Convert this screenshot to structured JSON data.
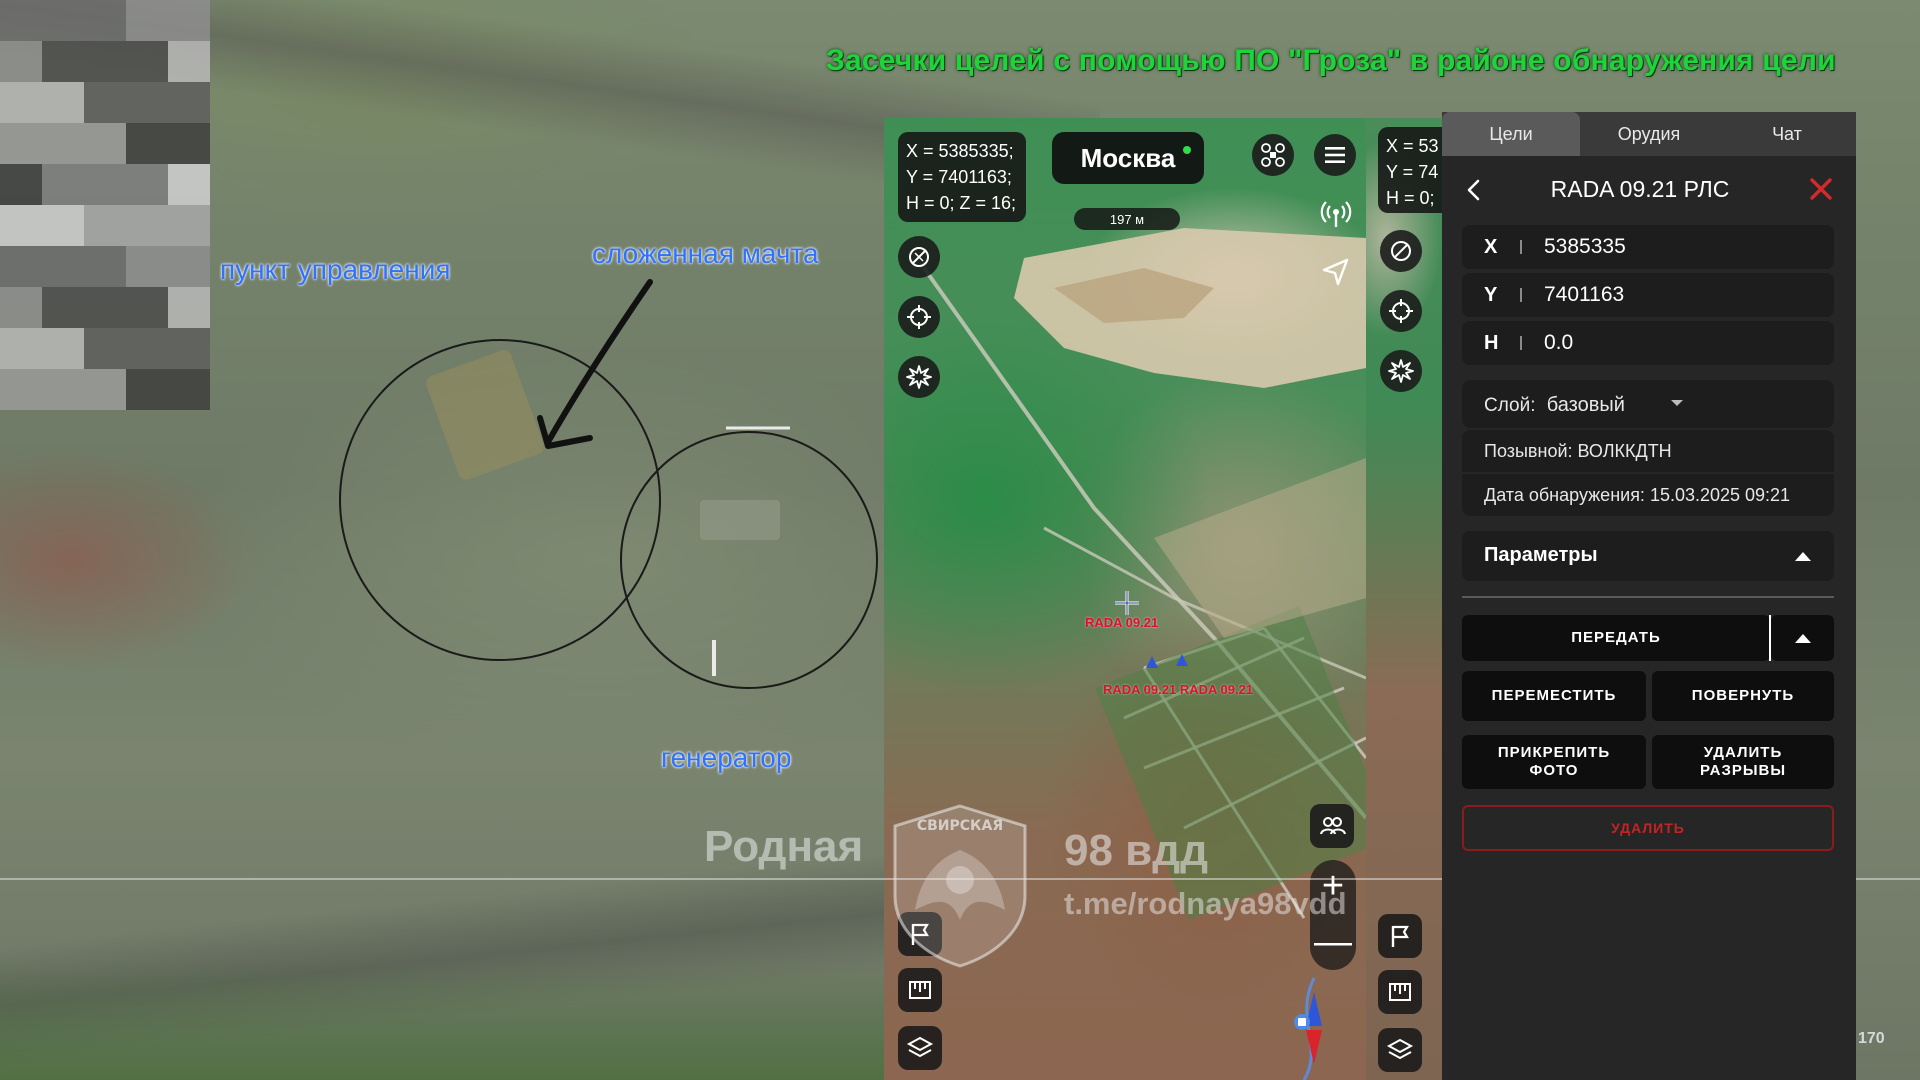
{
  "video_title": "Засечки целей с помощью ПО \"Гроза\" в районе обнаружения цели",
  "annotations": {
    "control_point": "пункт управления",
    "folded_mast": "сложенная мачта",
    "generator": "генератор"
  },
  "watermark": {
    "left": "Родная",
    "right": "98 вдд",
    "link": "t.me/rodnaya98vdd",
    "emblem_text": "СВИРСКАЯ"
  },
  "map": {
    "coords_main": "X = 5385335;\nY = 7401163;\nH = 0; Z = 16;",
    "coords_side": "X = 53\nY = 74\nH = 0;",
    "city": "Москва",
    "scale": "197 м",
    "target_label": "RADA 09.21",
    "target_label_2": "RADA 09.21 RADA 09.21",
    "zoom_in": "+",
    "zoom_out": "—",
    "status_color": "#2ede4a",
    "target_color": "#e0102a"
  },
  "panel": {
    "tabs": [
      "Цели",
      "Орудия",
      "Чат"
    ],
    "active_tab": "Цели",
    "title": "RADA 09.21 РЛС",
    "coordinates": [
      {
        "key": "X",
        "value": "5385335"
      },
      {
        "key": "Y",
        "value": "7401163"
      },
      {
        "key": "H",
        "value": "0.0"
      }
    ],
    "layer_label": "Слой:",
    "layer_value": "базовый",
    "callsign": "Позывной: ВОЛККДТН",
    "detection_date": "Дата обнаружения: 15.03.2025 09:21",
    "params_label": "Параметры",
    "send_label": "ПЕРЕДАТЬ",
    "move_label": "ПЕРЕМЕСТИТЬ",
    "rotate_label": "ПОВЕРНУТЬ",
    "attach_photo_label": "ПРИКРЕПИТЬ ФОТО",
    "remove_gaps_label": "УДАЛИТЬ РАЗРЫВЫ",
    "delete_label": "УДАЛИТЬ",
    "close_color": "#d42a2a"
  },
  "frame_counter": "170",
  "icons": [
    "antenna-icon",
    "navigate-icon",
    "satellite-icon",
    "crosshair-icon",
    "burst-icon",
    "menu-icon",
    "drone-icon",
    "group-icon",
    "flag-icon",
    "ruler-icon",
    "layers-icon",
    "compass-icon"
  ]
}
